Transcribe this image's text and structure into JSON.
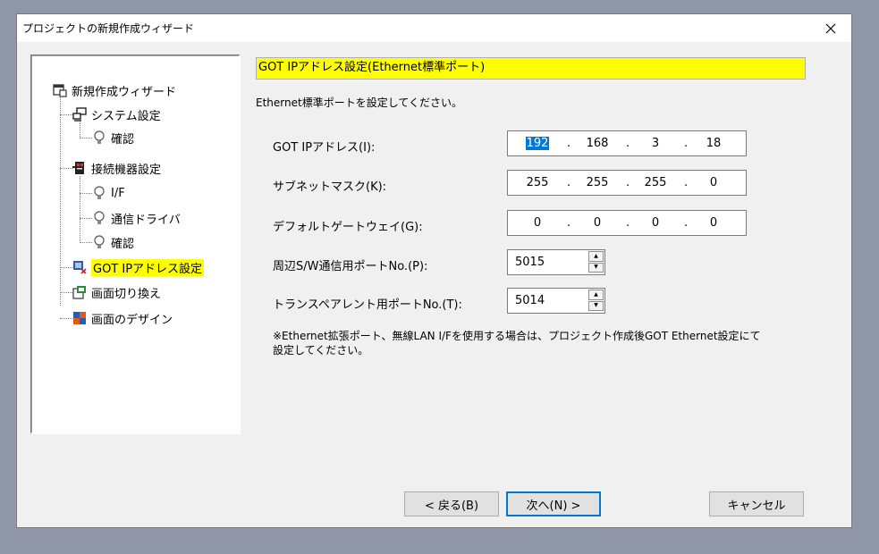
{
  "window": {
    "title": "プロジェクトの新規作成ウィザード"
  },
  "tree": {
    "items": [
      {
        "label": "新規作成ウィザード",
        "icon": "wizard-icon"
      },
      {
        "label": "システム設定",
        "icon": "system-icon"
      },
      {
        "label": "確認",
        "icon": "bulb-icon"
      },
      {
        "label": "接続機器設定",
        "icon": "device-icon"
      },
      {
        "label": "I/F",
        "icon": "bulb-icon"
      },
      {
        "label": "通信ドライバ",
        "icon": "bulb-icon"
      },
      {
        "label": "確認",
        "icon": "bulb-icon"
      },
      {
        "label": "GOT IPアドレス設定",
        "icon": "network-icon",
        "selected": true
      },
      {
        "label": "画面切り換え",
        "icon": "screen-switch-icon"
      },
      {
        "label": "画面のデザイン",
        "icon": "design-icon"
      }
    ]
  },
  "panel": {
    "header": "GOT IPアドレス設定(Ethernet標準ポート)",
    "description": "Ethernet標準ポートを設定してください。",
    "fields": {
      "got_ip": {
        "label": "GOT IPアドレス(I):",
        "octets": [
          "192",
          "168",
          "3",
          "18"
        ]
      },
      "subnet": {
        "label": "サブネットマスク(K):",
        "octets": [
          "255",
          "255",
          "255",
          "0"
        ]
      },
      "gateway": {
        "label": "デフォルトゲートウェイ(G):",
        "octets": [
          "0",
          "0",
          "0",
          "0"
        ]
      },
      "peripheral_port": {
        "label": "周辺S/W通信用ポートNo.(P):",
        "value": "5015"
      },
      "transparent_port": {
        "label": "トランスペアレント用ポートNo.(T):",
        "value": "5014"
      }
    },
    "note_line1": "※Ethernet拡張ポート、無線LAN I/Fを使用する場合は、プロジェクト作成後GOT Ethernet設定にて",
    "note_line2": "設定してください。"
  },
  "buttons": {
    "back": "< 戻る(B)",
    "next": "次へ(N) >",
    "cancel": "キャンセル"
  },
  "colors": {
    "highlight": "#ffff00",
    "selection": "#0078d7",
    "dialog_bg": "#f0f0f0",
    "desktop": "#8e96a8"
  }
}
